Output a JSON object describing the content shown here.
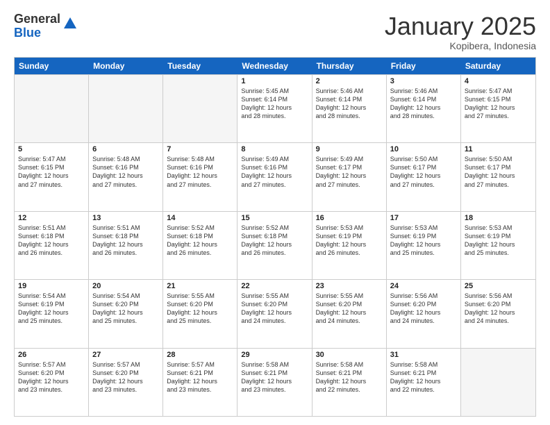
{
  "logo": {
    "general": "General",
    "blue": "Blue"
  },
  "header": {
    "month": "January 2025",
    "location": "Kopibera, Indonesia"
  },
  "weekdays": [
    "Sunday",
    "Monday",
    "Tuesday",
    "Wednesday",
    "Thursday",
    "Friday",
    "Saturday"
  ],
  "rows": [
    [
      {
        "day": "",
        "info": ""
      },
      {
        "day": "",
        "info": ""
      },
      {
        "day": "",
        "info": ""
      },
      {
        "day": "1",
        "info": "Sunrise: 5:45 AM\nSunset: 6:14 PM\nDaylight: 12 hours\nand 28 minutes."
      },
      {
        "day": "2",
        "info": "Sunrise: 5:46 AM\nSunset: 6:14 PM\nDaylight: 12 hours\nand 28 minutes."
      },
      {
        "day": "3",
        "info": "Sunrise: 5:46 AM\nSunset: 6:14 PM\nDaylight: 12 hours\nand 28 minutes."
      },
      {
        "day": "4",
        "info": "Sunrise: 5:47 AM\nSunset: 6:15 PM\nDaylight: 12 hours\nand 27 minutes."
      }
    ],
    [
      {
        "day": "5",
        "info": "Sunrise: 5:47 AM\nSunset: 6:15 PM\nDaylight: 12 hours\nand 27 minutes."
      },
      {
        "day": "6",
        "info": "Sunrise: 5:48 AM\nSunset: 6:16 PM\nDaylight: 12 hours\nand 27 minutes."
      },
      {
        "day": "7",
        "info": "Sunrise: 5:48 AM\nSunset: 6:16 PM\nDaylight: 12 hours\nand 27 minutes."
      },
      {
        "day": "8",
        "info": "Sunrise: 5:49 AM\nSunset: 6:16 PM\nDaylight: 12 hours\nand 27 minutes."
      },
      {
        "day": "9",
        "info": "Sunrise: 5:49 AM\nSunset: 6:17 PM\nDaylight: 12 hours\nand 27 minutes."
      },
      {
        "day": "10",
        "info": "Sunrise: 5:50 AM\nSunset: 6:17 PM\nDaylight: 12 hours\nand 27 minutes."
      },
      {
        "day": "11",
        "info": "Sunrise: 5:50 AM\nSunset: 6:17 PM\nDaylight: 12 hours\nand 27 minutes."
      }
    ],
    [
      {
        "day": "12",
        "info": "Sunrise: 5:51 AM\nSunset: 6:18 PM\nDaylight: 12 hours\nand 26 minutes."
      },
      {
        "day": "13",
        "info": "Sunrise: 5:51 AM\nSunset: 6:18 PM\nDaylight: 12 hours\nand 26 minutes."
      },
      {
        "day": "14",
        "info": "Sunrise: 5:52 AM\nSunset: 6:18 PM\nDaylight: 12 hours\nand 26 minutes."
      },
      {
        "day": "15",
        "info": "Sunrise: 5:52 AM\nSunset: 6:18 PM\nDaylight: 12 hours\nand 26 minutes."
      },
      {
        "day": "16",
        "info": "Sunrise: 5:53 AM\nSunset: 6:19 PM\nDaylight: 12 hours\nand 26 minutes."
      },
      {
        "day": "17",
        "info": "Sunrise: 5:53 AM\nSunset: 6:19 PM\nDaylight: 12 hours\nand 25 minutes."
      },
      {
        "day": "18",
        "info": "Sunrise: 5:53 AM\nSunset: 6:19 PM\nDaylight: 12 hours\nand 25 minutes."
      }
    ],
    [
      {
        "day": "19",
        "info": "Sunrise: 5:54 AM\nSunset: 6:19 PM\nDaylight: 12 hours\nand 25 minutes."
      },
      {
        "day": "20",
        "info": "Sunrise: 5:54 AM\nSunset: 6:20 PM\nDaylight: 12 hours\nand 25 minutes."
      },
      {
        "day": "21",
        "info": "Sunrise: 5:55 AM\nSunset: 6:20 PM\nDaylight: 12 hours\nand 25 minutes."
      },
      {
        "day": "22",
        "info": "Sunrise: 5:55 AM\nSunset: 6:20 PM\nDaylight: 12 hours\nand 24 minutes."
      },
      {
        "day": "23",
        "info": "Sunrise: 5:55 AM\nSunset: 6:20 PM\nDaylight: 12 hours\nand 24 minutes."
      },
      {
        "day": "24",
        "info": "Sunrise: 5:56 AM\nSunset: 6:20 PM\nDaylight: 12 hours\nand 24 minutes."
      },
      {
        "day": "25",
        "info": "Sunrise: 5:56 AM\nSunset: 6:20 PM\nDaylight: 12 hours\nand 24 minutes."
      }
    ],
    [
      {
        "day": "26",
        "info": "Sunrise: 5:57 AM\nSunset: 6:20 PM\nDaylight: 12 hours\nand 23 minutes."
      },
      {
        "day": "27",
        "info": "Sunrise: 5:57 AM\nSunset: 6:20 PM\nDaylight: 12 hours\nand 23 minutes."
      },
      {
        "day": "28",
        "info": "Sunrise: 5:57 AM\nSunset: 6:21 PM\nDaylight: 12 hours\nand 23 minutes."
      },
      {
        "day": "29",
        "info": "Sunrise: 5:58 AM\nSunset: 6:21 PM\nDaylight: 12 hours\nand 23 minutes."
      },
      {
        "day": "30",
        "info": "Sunrise: 5:58 AM\nSunset: 6:21 PM\nDaylight: 12 hours\nand 22 minutes."
      },
      {
        "day": "31",
        "info": "Sunrise: 5:58 AM\nSunset: 6:21 PM\nDaylight: 12 hours\nand 22 minutes."
      },
      {
        "day": "",
        "info": ""
      }
    ]
  ]
}
